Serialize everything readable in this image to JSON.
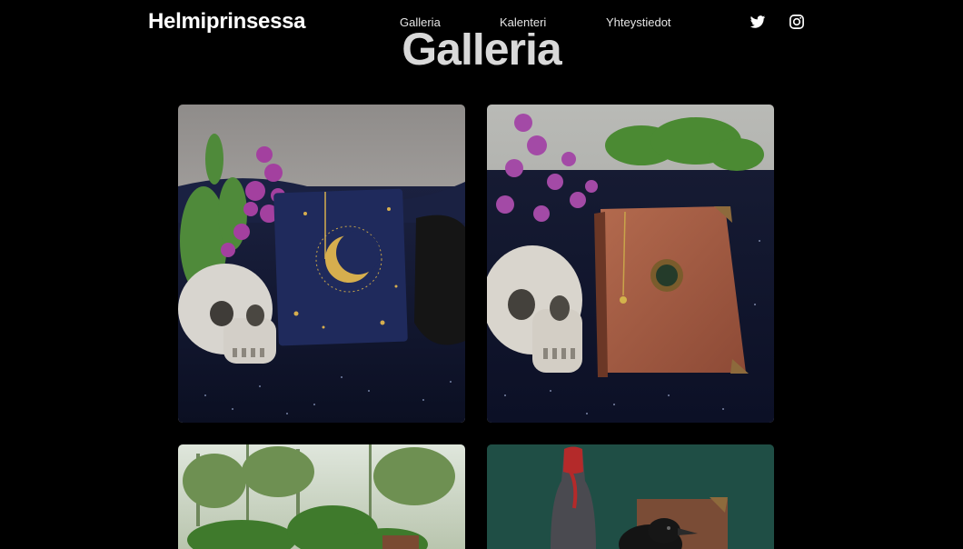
{
  "nav": {
    "brand": "Helmiprinsessa",
    "links": [
      "Galleria",
      "Kalenteri",
      "Yhteystiedot"
    ],
    "social": [
      "twitter-icon",
      "instagram-icon"
    ]
  },
  "page": {
    "heading": "Galleria"
  },
  "gallery": {
    "items": [
      {
        "subject": "skull-with-moon-notebook"
      },
      {
        "subject": "skull-with-leather-book"
      },
      {
        "subject": "book-in-garden"
      },
      {
        "subject": "bottle-and-raven-with-book"
      }
    ]
  },
  "colors": {
    "background": "#000000",
    "text": "#ffffff",
    "heading": "#d9d9d9"
  }
}
